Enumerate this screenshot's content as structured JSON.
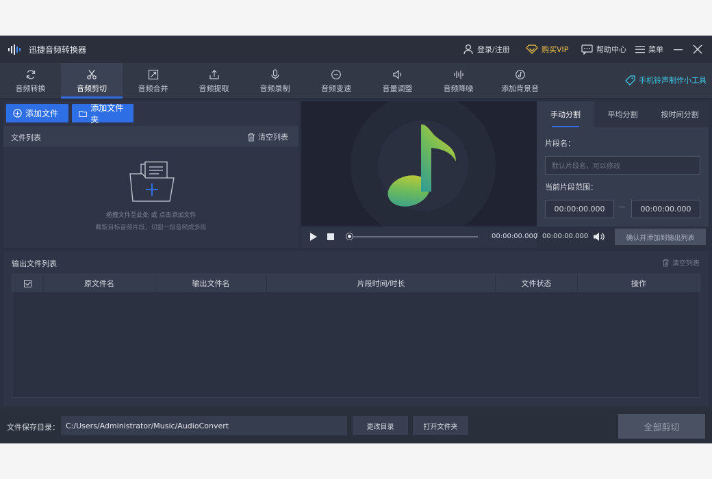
{
  "app": {
    "title": "迅捷音频转换器",
    "login": "登录/注册",
    "vip": "购买VIP",
    "help": "帮助中心",
    "menu": "菜单"
  },
  "toolbar": {
    "items": [
      {
        "label": "音频转换",
        "icon": "refresh-icon"
      },
      {
        "label": "音频剪切",
        "icon": "scissors-icon",
        "active": true
      },
      {
        "label": "音频合并",
        "icon": "merge-icon"
      },
      {
        "label": "音频提取",
        "icon": "extract-icon"
      },
      {
        "label": "音频录制",
        "icon": "microphone-icon"
      },
      {
        "label": "音频变速",
        "icon": "speed-icon"
      },
      {
        "label": "音量调整",
        "icon": "volume-icon"
      },
      {
        "label": "音频降噪",
        "icon": "noise-reduction-icon"
      },
      {
        "label": "添加背景音",
        "icon": "music-note-icon"
      }
    ],
    "promo": "手机铃声制作小工具"
  },
  "files": {
    "add_file": "添加文件",
    "add_folder": "添加文件夹",
    "list_title": "文件列表",
    "clear": "清空列表",
    "hint1": "拖拽文件至此处 或 点击添加文件",
    "hint2": "截取目标音频片段，切割一段音频成多段"
  },
  "player": {
    "current": "00:00:00.000",
    "separator": "/",
    "total": "00:00:00.000",
    "progress": 0,
    "confirm": "确认并添加到输出列表"
  },
  "split": {
    "tabs": [
      "手动分割",
      "平均分割",
      "按时间分割"
    ],
    "segment_label": "片段名：",
    "segment_placeholder": "默认片段名，可以修改",
    "range_label": "当前片段范围：",
    "start": "00:00:00.000",
    "end": "00:00:00.000"
  },
  "output": {
    "title": "输出文件列表",
    "clear": "清空列表",
    "columns": [
      "原文件名",
      "输出文件名",
      "片段时间/时长",
      "文件状态",
      "操作"
    ]
  },
  "footer": {
    "label": "文件保存目录：",
    "path": "C:/Users/Administrator/Music/AudioConvert",
    "change": "更改目录",
    "open": "打开文件夹",
    "cut_all": "全部剪切"
  },
  "colors": {
    "accent": "#2f6fe6",
    "vip": "#f3c244",
    "promo": "#3ec7e5"
  }
}
